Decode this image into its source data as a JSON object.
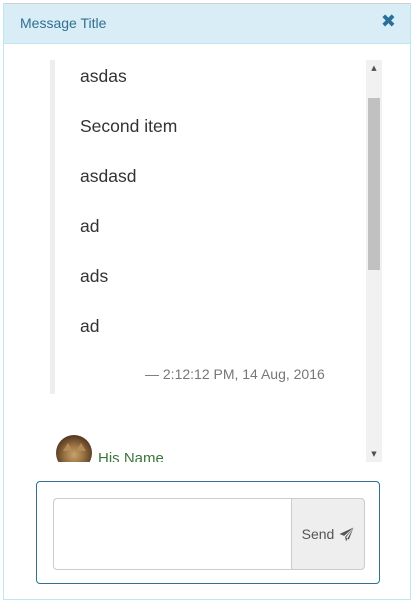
{
  "header": {
    "title": "Message Title",
    "close_icon": "close-icon"
  },
  "message": {
    "lines": [
      "asdas",
      "Second item",
      "asdasd",
      "ad",
      "ads",
      "ad"
    ],
    "footer": "— 2:12:12 PM, 14 Aug, 2016"
  },
  "sender": {
    "name": "His Name",
    "avatar": "cat-avatar"
  },
  "composer": {
    "input_value": "",
    "send_label": "Send",
    "send_icon": "paper-plane-icon"
  },
  "colors": {
    "header_bg": "#d9edf7",
    "header_text": "#31708f",
    "name_text": "#3c763d",
    "compose_border": "#31708f"
  }
}
